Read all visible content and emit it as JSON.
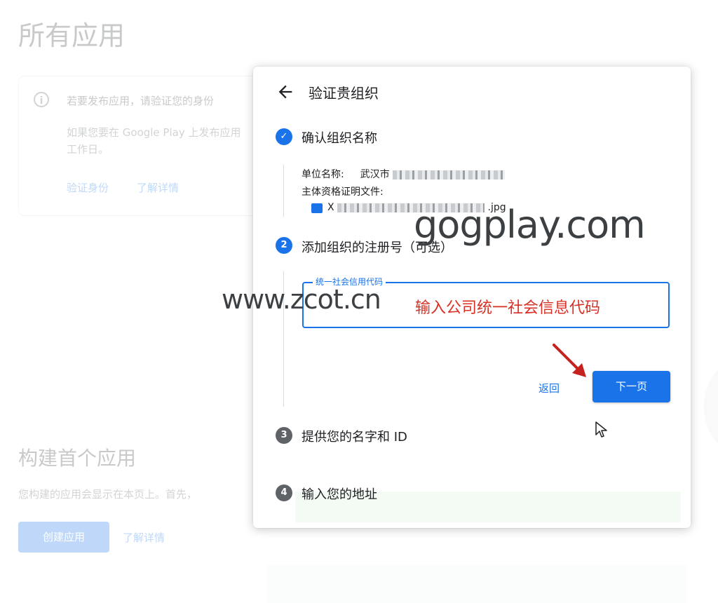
{
  "background": {
    "page_title": "所有应用",
    "notice_title": "若要发布应用，请验证您的身份",
    "notice_body": "如果您要在 Google Play 上发布应用 工作日。",
    "verify_link": "验证身份",
    "learn_more_link": "了解详情",
    "section_title": "构建首个应用",
    "section_body": "您构建的应用会显示在本页上。首先，",
    "create_button": "创建应用",
    "learn_more_link2": "了解详情"
  },
  "dialog": {
    "title": "验证贵组织",
    "steps": [
      {
        "number": "✓",
        "label": "确认组织名称",
        "state": "done"
      },
      {
        "number": "2",
        "label": "添加组织的注册号（可选）",
        "state": "active"
      },
      {
        "number": "3",
        "label": "提供您的名字和 ID",
        "state": "todo"
      },
      {
        "number": "4",
        "label": "输入您的地址",
        "state": "todo"
      }
    ],
    "org_name_label": "单位名称:",
    "org_name_value": "武汉市",
    "doc_label": "主体资格证明文件:",
    "doc_file_prefix": "X",
    "doc_file_suffix": ".jpg",
    "field_label": "统一社会信用代码",
    "field_hint": "输入公司统一社会信息代码",
    "back_button": "返回",
    "next_button": "下一页"
  },
  "watermarks": {
    "top": "gogplay.com",
    "bottom": "www.zcot.cn"
  },
  "colors": {
    "accent": "#1a73e8",
    "hint_red": "#d93025",
    "step_todo": "#5f6368",
    "arrow": "#c5221f"
  }
}
